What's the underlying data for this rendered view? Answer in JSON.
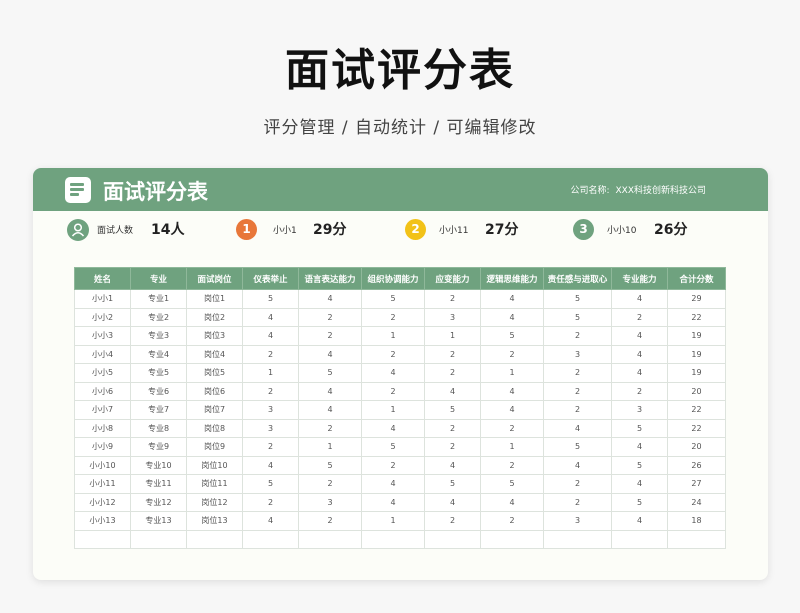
{
  "page": {
    "title": "面试评分表",
    "subtitle": "评分管理 / 自动统计 / 可编辑修改"
  },
  "card": {
    "title": "面试评分表",
    "company_label": "公司名称:",
    "company_name": "XXX科技创新科技公司"
  },
  "stats": {
    "count_label": "面试人数",
    "count_value": "14人",
    "ranks": [
      {
        "rank": "1",
        "name": "小小1",
        "score": "29分",
        "color": "#e8773a"
      },
      {
        "rank": "2",
        "name": "小小11",
        "score": "27分",
        "color": "#f2c218"
      },
      {
        "rank": "3",
        "name": "小小10",
        "score": "26分",
        "color": "#6fa27f"
      }
    ]
  },
  "colors": {
    "accent": "#6fa27f",
    "person_icon_bg": "#6fa27f"
  },
  "icons": {
    "header": "document-icon",
    "count": "person-icon"
  },
  "table": {
    "headers": [
      "姓名",
      "专业",
      "面试岗位",
      "仪表举止",
      "语言表达能力",
      "组织协调能力",
      "应变能力",
      "逻辑思维能力",
      "责任感与进取心",
      "专业能力",
      "合计分数"
    ],
    "rows": [
      [
        "小小1",
        "专业1",
        "岗位1",
        "5",
        "4",
        "5",
        "2",
        "4",
        "5",
        "4",
        "29"
      ],
      [
        "小小2",
        "专业2",
        "岗位2",
        "4",
        "2",
        "2",
        "3",
        "4",
        "5",
        "2",
        "22"
      ],
      [
        "小小3",
        "专业3",
        "岗位3",
        "4",
        "2",
        "1",
        "1",
        "5",
        "2",
        "4",
        "19"
      ],
      [
        "小小4",
        "专业4",
        "岗位4",
        "2",
        "4",
        "2",
        "2",
        "2",
        "3",
        "4",
        "19"
      ],
      [
        "小小5",
        "专业5",
        "岗位5",
        "1",
        "5",
        "4",
        "2",
        "1",
        "2",
        "4",
        "19"
      ],
      [
        "小小6",
        "专业6",
        "岗位6",
        "2",
        "4",
        "2",
        "4",
        "4",
        "2",
        "2",
        "20"
      ],
      [
        "小小7",
        "专业7",
        "岗位7",
        "3",
        "4",
        "1",
        "5",
        "4",
        "2",
        "3",
        "22"
      ],
      [
        "小小8",
        "专业8",
        "岗位8",
        "3",
        "2",
        "4",
        "2",
        "2",
        "4",
        "5",
        "22"
      ],
      [
        "小小9",
        "专业9",
        "岗位9",
        "2",
        "1",
        "5",
        "2",
        "1",
        "5",
        "4",
        "20"
      ],
      [
        "小小10",
        "专业10",
        "岗位10",
        "4",
        "5",
        "2",
        "4",
        "2",
        "4",
        "5",
        "26"
      ],
      [
        "小小11",
        "专业11",
        "岗位11",
        "5",
        "2",
        "4",
        "5",
        "5",
        "2",
        "4",
        "27"
      ],
      [
        "小小12",
        "专业12",
        "岗位12",
        "2",
        "3",
        "4",
        "4",
        "4",
        "2",
        "5",
        "24"
      ],
      [
        "小小13",
        "专业13",
        "岗位13",
        "4",
        "2",
        "1",
        "2",
        "2",
        "3",
        "4",
        "18"
      ],
      [
        "",
        "",
        "",
        "",
        "",
        "",
        "",
        "",
        "",
        "",
        ""
      ]
    ]
  }
}
